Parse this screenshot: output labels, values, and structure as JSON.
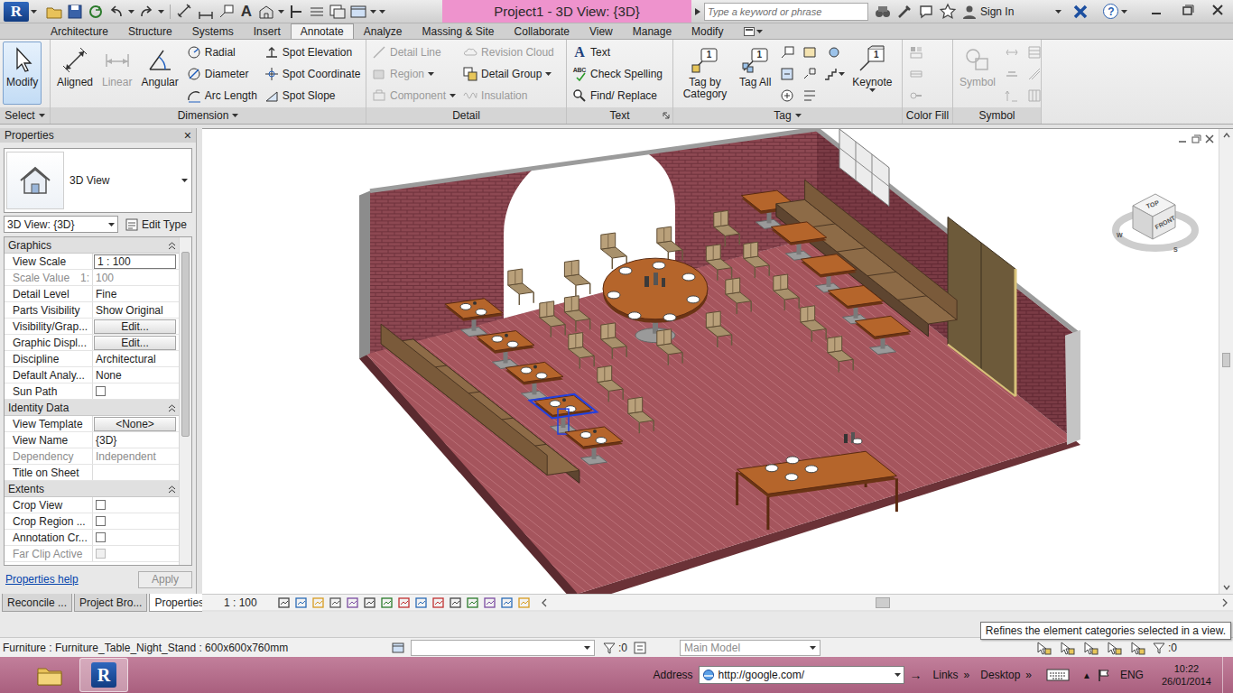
{
  "app": {
    "logo": "R",
    "title": "Project1 - 3D View: {3D}"
  },
  "quick_access": {
    "text_tool": "A"
  },
  "search": {
    "placeholder": "Type a keyword or phrase"
  },
  "account": {
    "sign_in": "Sign In",
    "help": "?"
  },
  "ribbon": {
    "tabs": [
      {
        "label": "Architecture",
        "selected": false
      },
      {
        "label": "Structure",
        "selected": false
      },
      {
        "label": "Systems",
        "selected": false
      },
      {
        "label": "Insert",
        "selected": false
      },
      {
        "label": "Annotate",
        "selected": true
      },
      {
        "label": "Analyze",
        "selected": false
      },
      {
        "label": "Massing & Site",
        "selected": false
      },
      {
        "label": "Collaborate",
        "selected": false
      },
      {
        "label": "View",
        "selected": false
      },
      {
        "label": "Manage",
        "selected": false
      },
      {
        "label": "Modify",
        "selected": false
      }
    ],
    "panels": [
      {
        "label": "Select",
        "menu": true,
        "launcher": false,
        "buttons": [
          {
            "label": "Modify",
            "kind": "big",
            "selected": true,
            "disabled": false,
            "menu": false
          }
        ]
      },
      {
        "label": "Dimension",
        "menu": true,
        "launcher": false,
        "buttons": [
          {
            "label": "Aligned",
            "kind": "big",
            "selected": false,
            "disabled": false,
            "menu": false
          },
          {
            "label": "Linear",
            "kind": "big",
            "selected": false,
            "disabled": true,
            "menu": false
          },
          {
            "label": "Angular",
            "kind": "big",
            "selected": false,
            "disabled": false,
            "menu": false
          },
          {
            "label": "Radial",
            "kind": "small",
            "selected": false,
            "disabled": false,
            "menu": false
          },
          {
            "label": "Diameter",
            "kind": "small",
            "selected": false,
            "disabled": false,
            "menu": false
          },
          {
            "label": "Arc Length",
            "kind": "small",
            "selected": false,
            "disabled": false,
            "menu": false
          },
          {
            "label": "Spot Elevation",
            "kind": "small",
            "selected": false,
            "disabled": false,
            "menu": false
          },
          {
            "label": "Spot Coordinate",
            "kind": "small",
            "selected": false,
            "disabled": false,
            "menu": false
          },
          {
            "label": "Spot Slope",
            "kind": "small",
            "selected": false,
            "disabled": false,
            "menu": false
          }
        ]
      },
      {
        "label": "Detail",
        "menu": false,
        "launcher": false,
        "buttons": [
          {
            "label": "Detail Line",
            "kind": "small",
            "selected": false,
            "disabled": true,
            "menu": false
          },
          {
            "label": "Region",
            "kind": "small",
            "selected": false,
            "disabled": true,
            "menu": true
          },
          {
            "label": "Component",
            "kind": "small",
            "selected": false,
            "disabled": true,
            "menu": true
          },
          {
            "label": "Revision Cloud",
            "kind": "small",
            "selected": false,
            "disabled": true,
            "menu": false
          },
          {
            "label": "Detail Group",
            "kind": "small",
            "selected": false,
            "disabled": false,
            "menu": true
          },
          {
            "label": "Insulation",
            "kind": "small",
            "selected": false,
            "disabled": true,
            "menu": false
          }
        ]
      },
      {
        "label": "Text",
        "menu": false,
        "launcher": true,
        "buttons": [
          {
            "label": "Text",
            "glyph": "A",
            "kind": "small",
            "selected": false,
            "disabled": false,
            "menu": false
          },
          {
            "label": "Check Spelling",
            "glyph": "ABC",
            "kind": "small",
            "selected": false,
            "disabled": false,
            "menu": false
          },
          {
            "label": "Find/ Replace",
            "kind": "small",
            "selected": false,
            "disabled": false,
            "menu": false
          }
        ]
      },
      {
        "label": "Tag",
        "menu": true,
        "launcher": false,
        "buttons": [
          {
            "label": "Tag by Category",
            "glyph": "1",
            "kind": "big",
            "selected": false,
            "disabled": false,
            "menu": false
          },
          {
            "label": "Tag All",
            "glyph": "1",
            "kind": "big",
            "selected": false,
            "disabled": false,
            "menu": false
          },
          {
            "kind": "icon",
            "selected": false,
            "disabled": false,
            "menu": false
          },
          {
            "kind": "icon",
            "selected": false,
            "disabled": false,
            "menu": false
          },
          {
            "kind": "icon",
            "selected": false,
            "disabled": false,
            "menu": false
          },
          {
            "kind": "icon",
            "selected": false,
            "disabled": false,
            "menu": false
          },
          {
            "kind": "icon",
            "selected": false,
            "disabled": false,
            "menu": false
          },
          {
            "kind": "icon",
            "selected": false,
            "disabled": false,
            "menu": false
          },
          {
            "kind": "icon",
            "selected": false,
            "disabled": false,
            "menu": false
          },
          {
            "kind": "icon",
            "selected": false,
            "disabled": false,
            "menu": true
          },
          {
            "label": "Keynote",
            "glyph": "1",
            "kind": "big",
            "selected": false,
            "disabled": false,
            "menu": true
          }
        ]
      },
      {
        "label": "Color Fill",
        "menu": false,
        "launcher": false,
        "buttons": [
          {
            "kind": "icon",
            "selected": false,
            "disabled": true,
            "menu": false
          },
          {
            "kind": "icon",
            "selected": false,
            "disabled": true,
            "menu": false
          },
          {
            "kind": "icon",
            "selected": false,
            "disabled": true,
            "menu": false
          }
        ]
      },
      {
        "label": "Symbol",
        "menu": false,
        "launcher": false,
        "buttons": [
          {
            "label": "Symbol",
            "kind": "big",
            "selected": false,
            "disabled": true,
            "menu": false
          },
          {
            "kind": "icon",
            "selected": false,
            "disabled": true,
            "menu": false
          },
          {
            "kind": "icon",
            "selected": false,
            "disabled": true,
            "menu": false
          },
          {
            "kind": "icon",
            "selected": false,
            "disabled": true,
            "menu": false
          },
          {
            "kind": "icon",
            "selected": false,
            "disabled": true,
            "menu": false
          },
          {
            "kind": "icon",
            "selected": false,
            "disabled": true,
            "menu": false
          },
          {
            "kind": "icon",
            "selected": false,
            "disabled": true,
            "menu": false
          }
        ]
      }
    ]
  },
  "properties": {
    "title": "Properties",
    "close": "×",
    "type_name": "3D View",
    "instance": "3D View: {3D}",
    "edit_type": "Edit Type",
    "groups": [
      {
        "label": "Graphics",
        "expanded": true,
        "rows": [
          {
            "label": "View Scale",
            "value": "1 : 100",
            "kind": "input",
            "disabled": false
          },
          {
            "label": "Scale Value",
            "suffix": "1:",
            "value": "100",
            "kind": "text",
            "disabled": true
          },
          {
            "label": "Detail Level",
            "value": "Fine",
            "kind": "text",
            "disabled": false
          },
          {
            "label": "Parts Visibility",
            "value": "Show Original",
            "kind": "text",
            "disabled": false
          },
          {
            "label": "Visibility/Grap...",
            "value": "Edit...",
            "kind": "button",
            "disabled": false
          },
          {
            "label": "Graphic Displ...",
            "value": "Edit...",
            "kind": "button",
            "disabled": false
          },
          {
            "label": "Discipline",
            "value": "Architectural",
            "kind": "text",
            "disabled": false
          },
          {
            "label": "Default Analy...",
            "value": "None",
            "kind": "text",
            "disabled": false
          },
          {
            "label": "Sun Path",
            "kind": "checkbox",
            "checked": false,
            "disabled": false
          }
        ]
      },
      {
        "label": "Identity Data",
        "expanded": true,
        "rows": [
          {
            "label": "View Template",
            "value": "<None>",
            "kind": "button",
            "disabled": false
          },
          {
            "label": "View Name",
            "value": "{3D}",
            "kind": "text",
            "disabled": false
          },
          {
            "label": "Dependency",
            "value": "Independent",
            "kind": "text",
            "disabled": true
          },
          {
            "label": "Title on Sheet",
            "value": "",
            "kind": "text",
            "disabled": false
          }
        ]
      },
      {
        "label": "Extents",
        "expanded": true,
        "rows": [
          {
            "label": "Crop View",
            "kind": "checkbox",
            "checked": false,
            "disabled": false
          },
          {
            "label": "Crop Region ...",
            "kind": "checkbox",
            "checked": false,
            "disabled": false
          },
          {
            "label": "Annotation Cr...",
            "kind": "checkbox",
            "checked": false,
            "disabled": false
          },
          {
            "label": "Far Clip Active",
            "kind": "checkbox",
            "checked": false,
            "disabled": true
          }
        ]
      }
    ],
    "help_link": "Properties help",
    "apply": {
      "label": "Apply",
      "disabled": true
    },
    "tabs": [
      {
        "label": "Reconcile ...",
        "selected": false
      },
      {
        "label": "Project Bro...",
        "selected": false
      },
      {
        "label": "Properties",
        "selected": true
      }
    ]
  },
  "view": {
    "scale": "1 : 100",
    "viewcube": {
      "top": "TOP",
      "front": "FRONT",
      "west": "W",
      "south": "S"
    }
  },
  "status": {
    "selection": "Furniture : Furniture_Table_Night_Stand : 600x600x760mm",
    "count_left": ":0",
    "model": "Main Model",
    "count_right": ":0"
  },
  "tooltip": {
    "text": "Refines the element categories selected in a view."
  },
  "taskbar": {
    "apps": [
      {
        "kind": "folder",
        "selected": false
      },
      {
        "kind": "revit",
        "selected": true
      }
    ],
    "address_label": "Address",
    "address": "http://google.com/",
    "go": "→",
    "links": "Links",
    "links_more": "»",
    "desktop": "Desktop",
    "desktop_more": "»",
    "tray_arrow": "▲",
    "language": "ENG",
    "time": "10:22",
    "date": "26/01/2014"
  }
}
